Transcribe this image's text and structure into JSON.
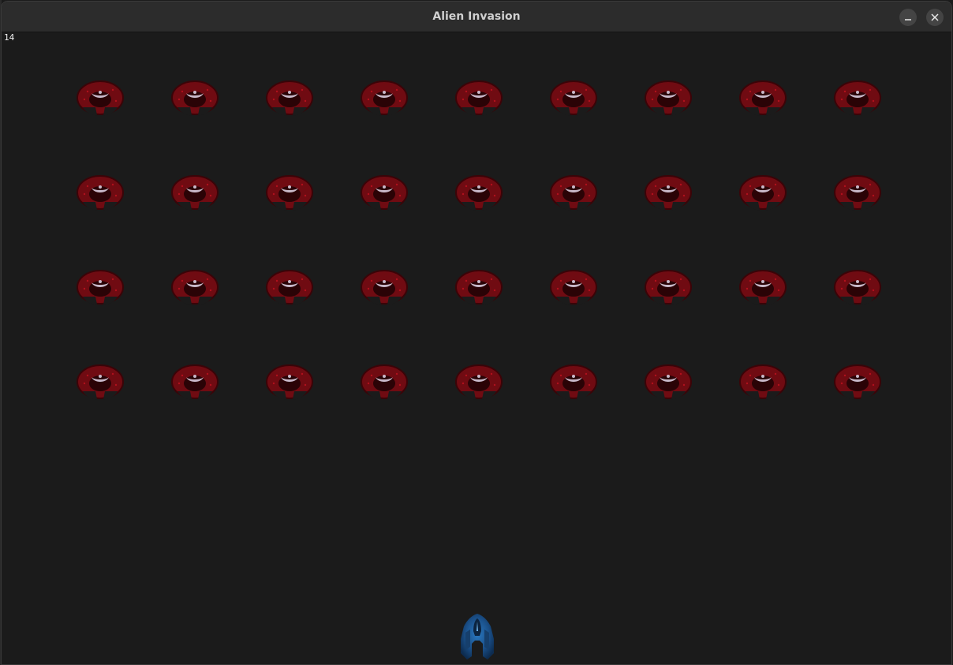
{
  "window": {
    "title": "Alien Invasion",
    "minimize_icon": "minimize-icon",
    "close_icon": "close-icon"
  },
  "hud": {
    "fps_counter": "14"
  },
  "fleet": {
    "rows": 4,
    "columns": 9,
    "alien_icon": "alien-icon",
    "alien_color": "#7a0a12",
    "alien_highlight": "#c8b8c8"
  },
  "player": {
    "ship_icon": "ship-icon",
    "ship_color": "#1f5a9a"
  },
  "colors": {
    "background": "#1b1b1b",
    "titlebar": "#2c2c2c",
    "title_text": "#d0d0d0"
  }
}
